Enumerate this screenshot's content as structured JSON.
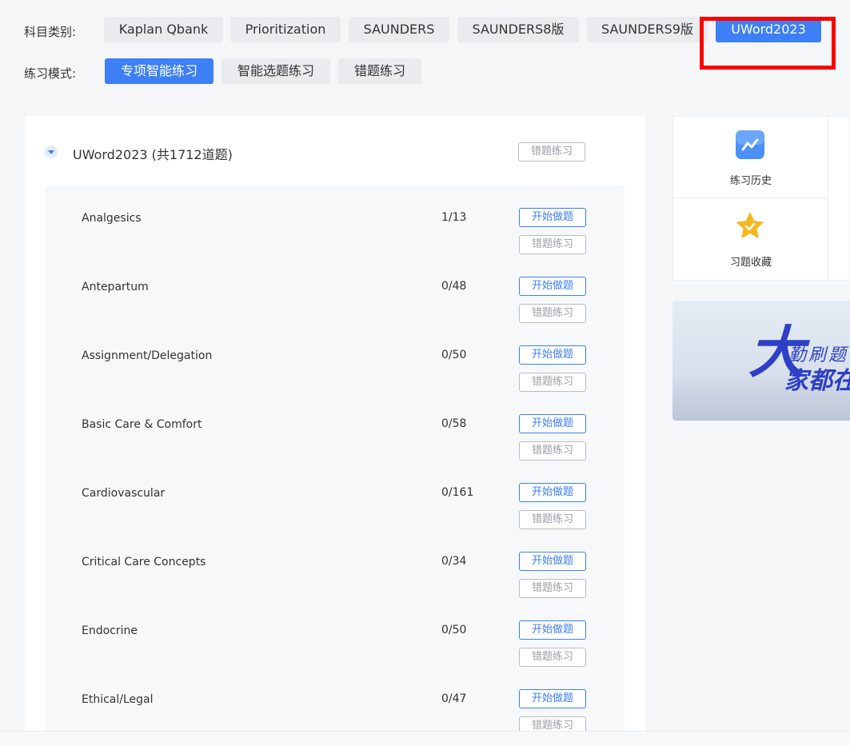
{
  "filters": {
    "category_label": "科目类别:",
    "categories": [
      {
        "label": "Kaplan Qbank",
        "active": false
      },
      {
        "label": "Prioritization",
        "active": false
      },
      {
        "label": "SAUNDERS",
        "active": false
      },
      {
        "label": "SAUNDERS8版",
        "active": false
      },
      {
        "label": "SAUNDERS9版",
        "active": false
      },
      {
        "label": "UWord2023",
        "active": true
      }
    ],
    "mode_label": "练习模式:",
    "modes": [
      {
        "label": "专项智能练习",
        "active": true
      },
      {
        "label": "智能选题练习",
        "active": false
      },
      {
        "label": "错题练习",
        "active": false
      }
    ]
  },
  "bank": {
    "title": "UWord2023 (共1712道题)",
    "wrong_practice_label": "错题练习"
  },
  "topic_actions": {
    "start": "开始做题",
    "wrong": "错题练习"
  },
  "topics": [
    {
      "name": "Analgesics",
      "count": "1/13"
    },
    {
      "name": "Antepartum",
      "count": "0/48"
    },
    {
      "name": "Assignment/Delegation",
      "count": "0/50"
    },
    {
      "name": "Basic Care & Comfort",
      "count": "0/58"
    },
    {
      "name": "Cardiovascular",
      "count": "0/161"
    },
    {
      "name": "Critical Care Concepts",
      "count": "0/34"
    },
    {
      "name": "Endocrine",
      "count": "0/50"
    },
    {
      "name": "Ethical/Legal",
      "count": "0/47"
    }
  ],
  "side": {
    "history_label": "练习历史",
    "favorites_label": "习题收藏"
  },
  "banner": {
    "big_char": "大",
    "line1": "勤刷题",
    "line2": "家都在"
  },
  "colors": {
    "accent": "#3d7ff5",
    "highlight": "#ff0000",
    "star": "#f5b820"
  }
}
